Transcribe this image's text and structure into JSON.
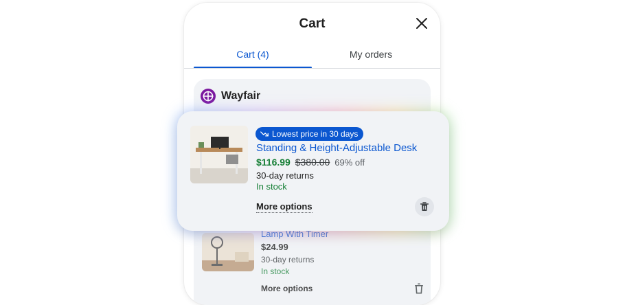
{
  "header": {
    "title": "Cart",
    "close_icon": "close-icon"
  },
  "tabs": [
    {
      "label": "Cart (4)",
      "active": true
    },
    {
      "label": "My orders",
      "active": false
    }
  ],
  "store": {
    "name": "Wayfair",
    "logo_icon": "wayfair-logo-icon",
    "brand_color": "#7b189f"
  },
  "items": [
    {
      "badge": "Lowest price in 30 days",
      "badge_icon": "trending-down-icon",
      "title": "Standing & Height-Adjustable Desk",
      "price": "$116.99",
      "original_price": "$380.00",
      "discount": "69% off",
      "returns": "30-day returns",
      "stock": "In stock",
      "more_options": "More options",
      "delete_icon": "trash-icon"
    },
    {
      "title": "Lamp With Timer",
      "price": "$24.99",
      "returns": "30-day returns",
      "stock": "In stock",
      "more_options": "More options",
      "delete_icon": "trash-icon"
    }
  ],
  "colors": {
    "accent": "#0b57d0",
    "price_green": "#188038",
    "card_bg": "#f1f3f6"
  }
}
